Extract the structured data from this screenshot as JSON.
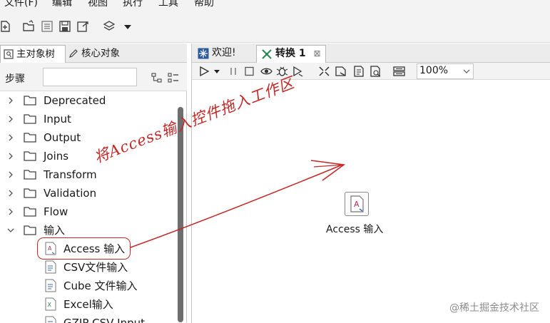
{
  "menu": [
    "文件(F)",
    "编辑",
    "视图",
    "执行",
    "工具",
    "帮助"
  ],
  "toolbar": {
    "icons": [
      "new-file-icon",
      "open-folder-icon",
      "explore-icon",
      "save-icon",
      "save-as-icon",
      "layers-icon",
      "dropdown-icon"
    ]
  },
  "left_panel": {
    "tabs": [
      {
        "label": "主对象树",
        "icon": "tree-icon",
        "active": true
      },
      {
        "label": "核心对象",
        "icon": "pencil-icon",
        "active": false
      }
    ],
    "steps_label": "步骤",
    "search_value": "",
    "tree": [
      {
        "label": "Deprecated",
        "expanded": false
      },
      {
        "label": "Input",
        "expanded": false
      },
      {
        "label": "Output",
        "expanded": false
      },
      {
        "label": "Joins",
        "expanded": false
      },
      {
        "label": "Transform",
        "expanded": false
      },
      {
        "label": "Validation",
        "expanded": false
      },
      {
        "label": "Flow",
        "expanded": false
      },
      {
        "label": "输入",
        "expanded": true
      }
    ],
    "leaves": [
      {
        "label": "Access 输入",
        "highlighted": true
      },
      {
        "label": "CSV文件输入"
      },
      {
        "label": "Cube 文件输入"
      },
      {
        "label": "Excel输入"
      },
      {
        "label": "GZIP CSV Input"
      }
    ]
  },
  "editor": {
    "tabs": [
      {
        "label": "欢迎!",
        "icon": "welcome-icon",
        "active": false,
        "closable": false
      },
      {
        "label": "转换 1",
        "icon": "transform-icon",
        "active": true,
        "closable": true,
        "close_glyph": "⊠"
      }
    ],
    "zoom": "100%",
    "canvas_node": {
      "label": "Access 输入",
      "icon": "access-input-icon"
    }
  },
  "annotation": {
    "text": "将Access输入控件拖入工作区",
    "color": "#c62828"
  },
  "watermark": "@稀土掘金技术社区",
  "colors": {
    "accent": "#c62828",
    "panel_bg": "#f3f3f3",
    "scrollbar": "#6e6e6e"
  }
}
